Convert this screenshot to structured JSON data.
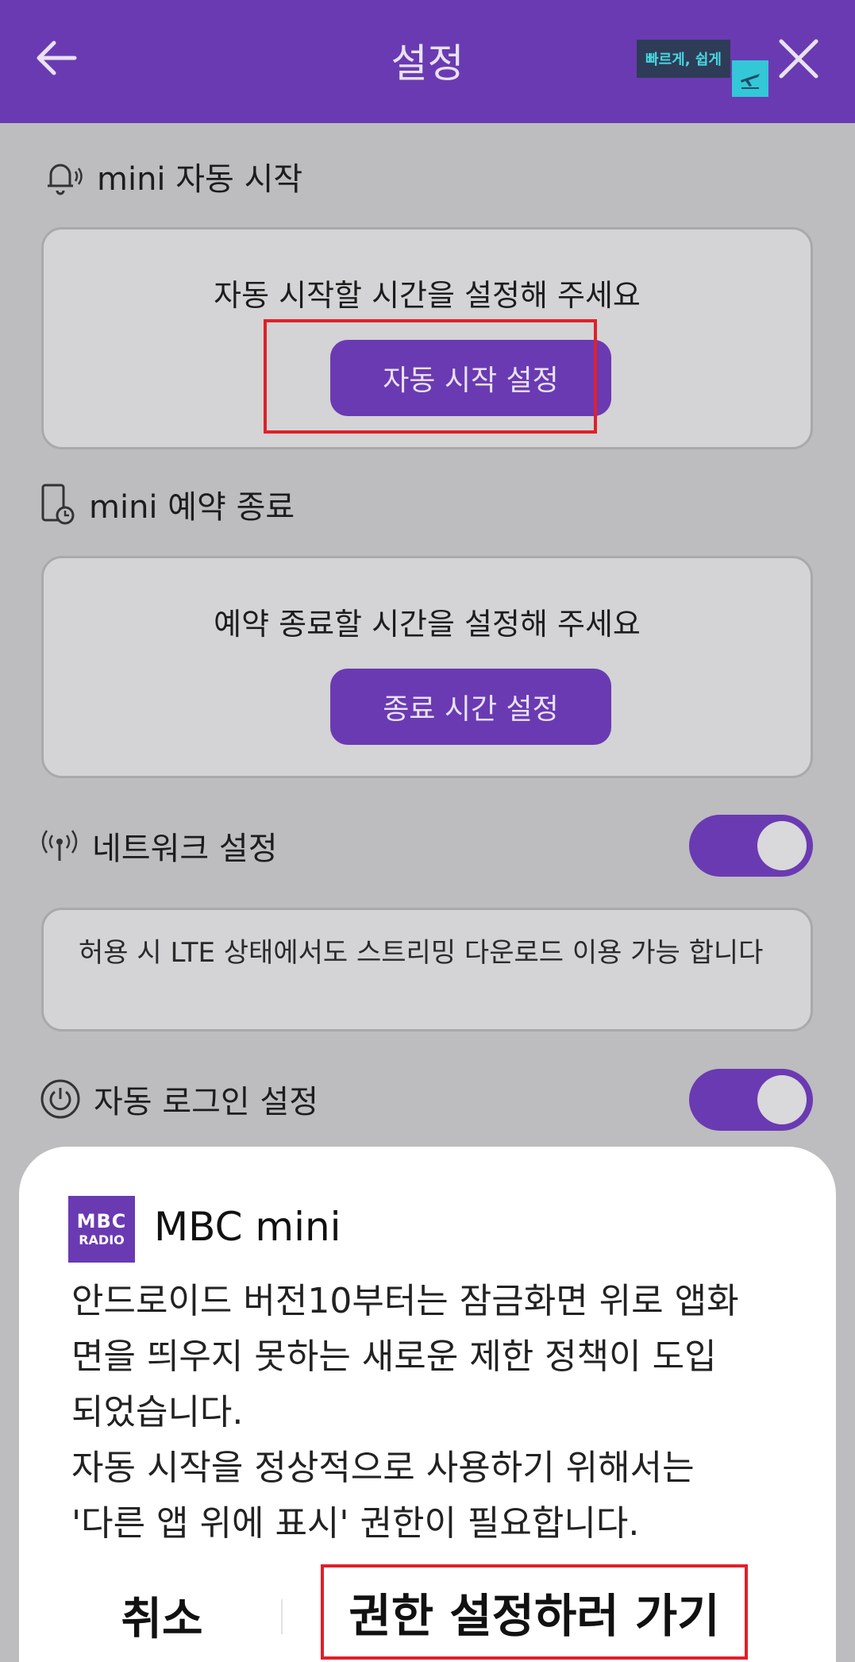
{
  "header": {
    "title": "설정",
    "ad_badge": "빠르게, 쉽게",
    "back_icon": "arrow-left-icon",
    "close_icon": "close-icon",
    "color": "#6a3ab2"
  },
  "auto_start": {
    "heading": "mini 자동 시작",
    "message": "자동 시작할 시간을 설정해 주세요",
    "button": "자동 시작 설정",
    "icon": "bell-icon"
  },
  "scheduled_end": {
    "heading": "mini 예약 종료",
    "message": "예약 종료할 시간을 설정해 주세요",
    "button": "종료 시간 설정",
    "icon": "phone-clock-icon"
  },
  "network": {
    "heading": "네트워크 설정",
    "toggle_on": true,
    "message": "허용 시 LTE 상태에서도 스트리밍 다운로드 이용 가능 합니다",
    "icon": "antenna-icon"
  },
  "auto_login": {
    "heading": "자동 로그인 설정",
    "toggle_on": true,
    "icon": "power-icon"
  },
  "dialog": {
    "logo_line1": "MBC",
    "logo_line2": "RADIO",
    "app_name": "MBC mini",
    "body_lines": [
      "안드로이드 버전10부터는 잠금화면 위로 앱화",
      "면을 띄우지 못하는 새로운 제한 정책이 도입",
      "되었습니다.",
      "자동 시작을 정상적으로 사용하기 위해서는",
      "'다른 앱 위에 표시' 권한이 필요합니다."
    ],
    "cancel": "취소",
    "confirm": "권한 설정하러 가기"
  }
}
